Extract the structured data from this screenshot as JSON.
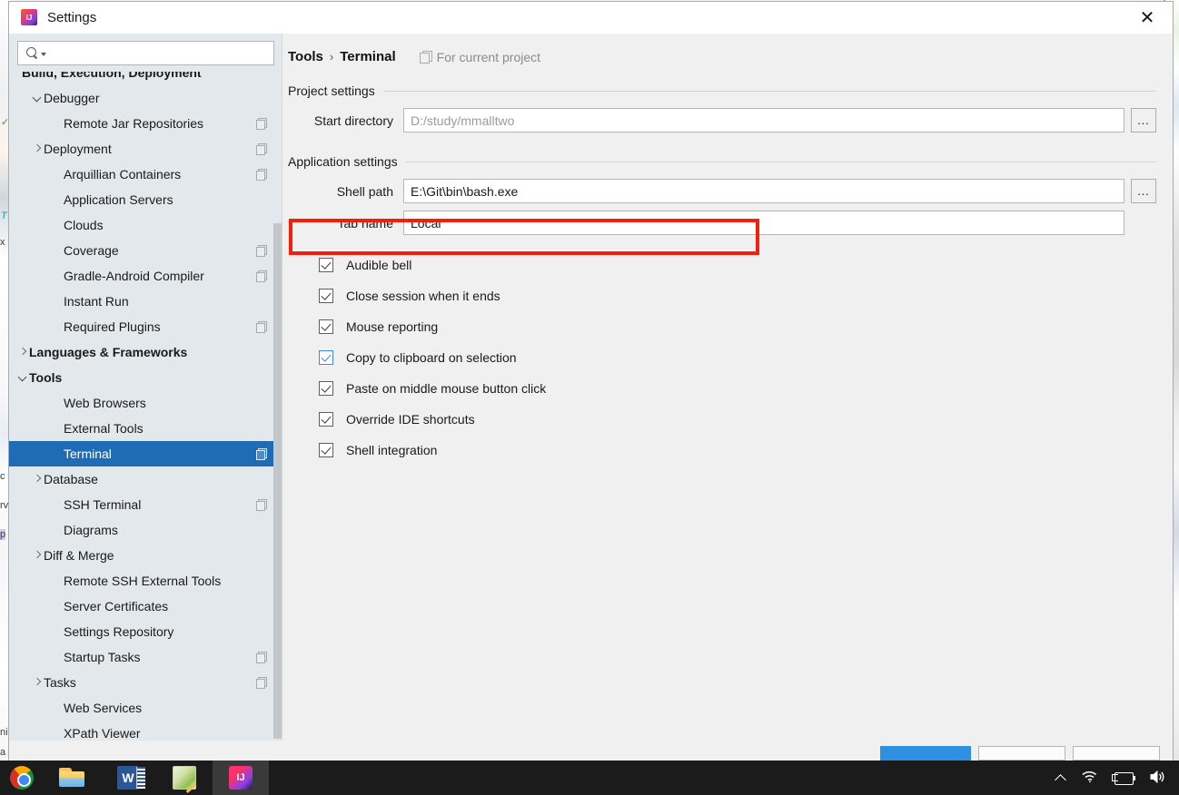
{
  "window": {
    "title": "Settings",
    "app_icon": "intellij-idea-icon",
    "close_label": "✕"
  },
  "search": {
    "value": "",
    "placeholder": "",
    "icon": "search-icon"
  },
  "sidebar": {
    "items": [
      {
        "label": "Build, Execution, Deployment",
        "bold": true,
        "indent": 10,
        "arrow": "",
        "project_icon": false,
        "selected": false
      },
      {
        "label": "Debugger",
        "bold": false,
        "indent": 38,
        "arrow": "down",
        "project_icon": false,
        "selected": false
      },
      {
        "label": "Remote Jar Repositories",
        "bold": false,
        "indent": 60,
        "arrow": "",
        "project_icon": true,
        "selected": false
      },
      {
        "label": "Deployment",
        "bold": false,
        "indent": 38,
        "arrow": "right",
        "project_icon": true,
        "selected": false
      },
      {
        "label": "Arquillian Containers",
        "bold": false,
        "indent": 60,
        "arrow": "",
        "project_icon": true,
        "selected": false
      },
      {
        "label": "Application Servers",
        "bold": false,
        "indent": 60,
        "arrow": "",
        "project_icon": false,
        "selected": false
      },
      {
        "label": "Clouds",
        "bold": false,
        "indent": 60,
        "arrow": "",
        "project_icon": false,
        "selected": false
      },
      {
        "label": "Coverage",
        "bold": false,
        "indent": 60,
        "arrow": "",
        "project_icon": true,
        "selected": false
      },
      {
        "label": "Gradle-Android Compiler",
        "bold": false,
        "indent": 60,
        "arrow": "",
        "project_icon": true,
        "selected": false
      },
      {
        "label": "Instant Run",
        "bold": false,
        "indent": 60,
        "arrow": "",
        "project_icon": false,
        "selected": false
      },
      {
        "label": "Required Plugins",
        "bold": false,
        "indent": 60,
        "arrow": "",
        "project_icon": true,
        "selected": false
      },
      {
        "label": "Languages & Frameworks",
        "bold": true,
        "indent": 22,
        "arrow": "right",
        "project_icon": false,
        "selected": false
      },
      {
        "label": "Tools",
        "bold": true,
        "indent": 22,
        "arrow": "down",
        "project_icon": false,
        "selected": false
      },
      {
        "label": "Web Browsers",
        "bold": false,
        "indent": 60,
        "arrow": "",
        "project_icon": false,
        "selected": false
      },
      {
        "label": "External Tools",
        "bold": false,
        "indent": 60,
        "arrow": "",
        "project_icon": false,
        "selected": false
      },
      {
        "label": "Terminal",
        "bold": false,
        "indent": 60,
        "arrow": "",
        "project_icon": true,
        "selected": true
      },
      {
        "label": "Database",
        "bold": false,
        "indent": 38,
        "arrow": "right",
        "project_icon": false,
        "selected": false
      },
      {
        "label": "SSH Terminal",
        "bold": false,
        "indent": 60,
        "arrow": "",
        "project_icon": true,
        "selected": false
      },
      {
        "label": "Diagrams",
        "bold": false,
        "indent": 60,
        "arrow": "",
        "project_icon": false,
        "selected": false
      },
      {
        "label": "Diff & Merge",
        "bold": false,
        "indent": 38,
        "arrow": "right",
        "project_icon": false,
        "selected": false
      },
      {
        "label": "Remote SSH External Tools",
        "bold": false,
        "indent": 60,
        "arrow": "",
        "project_icon": false,
        "selected": false
      },
      {
        "label": "Server Certificates",
        "bold": false,
        "indent": 60,
        "arrow": "",
        "project_icon": false,
        "selected": false
      },
      {
        "label": "Settings Repository",
        "bold": false,
        "indent": 60,
        "arrow": "",
        "project_icon": false,
        "selected": false
      },
      {
        "label": "Startup Tasks",
        "bold": false,
        "indent": 60,
        "arrow": "",
        "project_icon": true,
        "selected": false
      },
      {
        "label": "Tasks",
        "bold": false,
        "indent": 38,
        "arrow": "right",
        "project_icon": true,
        "selected": false
      },
      {
        "label": "Web Services",
        "bold": false,
        "indent": 60,
        "arrow": "",
        "project_icon": false,
        "selected": false
      },
      {
        "label": "XPath Viewer",
        "bold": false,
        "indent": 60,
        "arrow": "",
        "project_icon": false,
        "selected": false
      }
    ]
  },
  "main": {
    "breadcrumb": {
      "root": "Tools",
      "separator": "›",
      "current": "Terminal"
    },
    "scope": {
      "label": "For current project",
      "icon": "project-scope-icon"
    },
    "project_section": {
      "title": "Project settings",
      "start_directory": {
        "label": "Start directory",
        "value": "",
        "placeholder": "D:/study/mmalltwo",
        "browse_label": "…"
      }
    },
    "application_section": {
      "title": "Application settings",
      "shell_path": {
        "label": "Shell path",
        "value": "E:\\Git\\bin\\bash.exe",
        "placeholder": "",
        "browse_label": "…",
        "highlighted": true,
        "highlight_color": "#f21f0d"
      },
      "tab_name": {
        "label": "Tab name",
        "value": "Local",
        "placeholder": ""
      },
      "checkboxes": [
        {
          "label": "Audible bell",
          "checked": true,
          "focused": false
        },
        {
          "label": "Close session when it ends",
          "checked": true,
          "focused": false
        },
        {
          "label": "Mouse reporting",
          "checked": true,
          "focused": false
        },
        {
          "label": "Copy to clipboard on selection",
          "checked": true,
          "focused": true
        },
        {
          "label": "Paste on middle mouse button click",
          "checked": true,
          "focused": false
        },
        {
          "label": "Override IDE shortcuts",
          "checked": true,
          "focused": false
        },
        {
          "label": "Shell integration",
          "checked": true,
          "focused": false
        }
      ]
    }
  },
  "taskbar": {
    "items": [
      {
        "name": "chrome",
        "active": false
      },
      {
        "name": "explorer",
        "active": false
      },
      {
        "name": "word",
        "active": false
      },
      {
        "name": "editor",
        "active": false
      },
      {
        "name": "intellij",
        "active": true
      }
    ],
    "tray": [
      {
        "name": "show-hidden-icons",
        "glyph": ""
      },
      {
        "name": "wifi",
        "glyph": "◠"
      },
      {
        "name": "battery",
        "glyph": ""
      },
      {
        "name": "volume",
        "glyph": "🔊"
      }
    ]
  },
  "background": {
    "snippets": [
      "✓",
      "T",
      "x",
      "c",
      "rv",
      "p",
      "ni",
      "a"
    ]
  },
  "colors": {
    "selection_blue": "#1f6cb5",
    "annotation_red": "#f21f0d",
    "dialog_border": "#65c7d0",
    "sidebar_bg": "#e3e8ec",
    "panel_bg": "#f0f0f0"
  }
}
